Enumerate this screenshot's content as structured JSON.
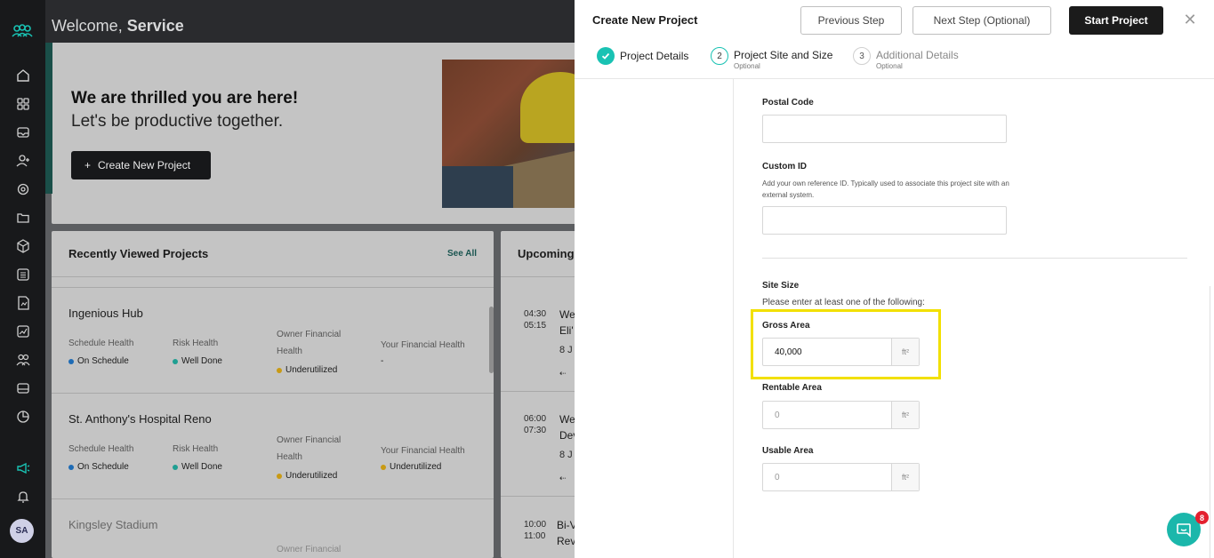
{
  "dashboard": {
    "welcome_prefix": "Welcome,",
    "welcome_name": "Service",
    "hero": {
      "line1": "We are thrilled you are here!",
      "line2": "Let's be productive together.",
      "cta_label": "Create New Project"
    },
    "recent": {
      "title": "Recently Viewed Projects",
      "see_all": "See All",
      "projects": [
        {
          "name": "Ingenious Hub",
          "schedule_label": "Schedule Health",
          "schedule_value": "On Schedule",
          "risk_label": "Risk Health",
          "risk_value": "Well Done",
          "owner_label_1": "Owner Financial",
          "owner_label_2": "Health",
          "owner_value": "Underutilized",
          "your_label": "Your Financial Health",
          "your_value": "-"
        },
        {
          "name": "St. Anthony's Hospital Reno",
          "schedule_label": "Schedule Health",
          "schedule_value": "On Schedule",
          "risk_label": "Risk Health",
          "risk_value": "Well Done",
          "owner_label_1": "Owner Financial",
          "owner_label_2": "Health",
          "owner_value": "Underutilized",
          "your_label": "Your Financial Health",
          "your_value": "Underutilized"
        },
        {
          "name": "Kingsley Stadium",
          "owner_label_1": "Owner Financial"
        }
      ]
    },
    "upcoming": {
      "title": "Upcoming",
      "items": [
        {
          "start": "04:30",
          "end": "05:15",
          "line1": "We",
          "line2": "Eli'",
          "date": "8 J"
        },
        {
          "start": "06:00",
          "end": "07:30",
          "line1": "We",
          "line2": "Dev",
          "date": "8 J"
        },
        {
          "start": "10:00",
          "end": "11:00",
          "line1": "Bi-V",
          "line2": "Rev",
          "date": ""
        }
      ]
    },
    "avatar_initials": "SA",
    "colors": {
      "on_schedule": "#1e6bb5",
      "well_done": "#1f9f92",
      "underutilized": "#c99a14"
    }
  },
  "panel": {
    "title": "Create New Project",
    "previous_step": "Previous Step",
    "next_step": "Next Step (Optional)",
    "start_project": "Start Project",
    "steps": [
      {
        "number": "",
        "label": "Project Details",
        "sub": ""
      },
      {
        "number": "2",
        "label": "Project Site and Size",
        "sub": "Optional"
      },
      {
        "number": "3",
        "label": "Additional Details",
        "sub": "Optional"
      }
    ],
    "postal_code_label": "Postal Code",
    "postal_code_value": "",
    "custom_id_label": "Custom ID",
    "custom_id_desc": "Add your own reference ID. Typically used to associate this project site with an external system.",
    "custom_id_value": "",
    "site_size_label": "Site Size",
    "site_size_hint": "Please enter at least one of the following:",
    "gross_area_label": "Gross Area",
    "gross_area_value": "40,000",
    "rentable_area_label": "Rentable Area",
    "rentable_area_value": "0",
    "usable_area_label": "Usable Area",
    "usable_area_value": "0",
    "unit": "ft²",
    "accent_color": "#19c2b3",
    "highlight_color": "#f2e000"
  },
  "chat": {
    "badge": "8"
  }
}
